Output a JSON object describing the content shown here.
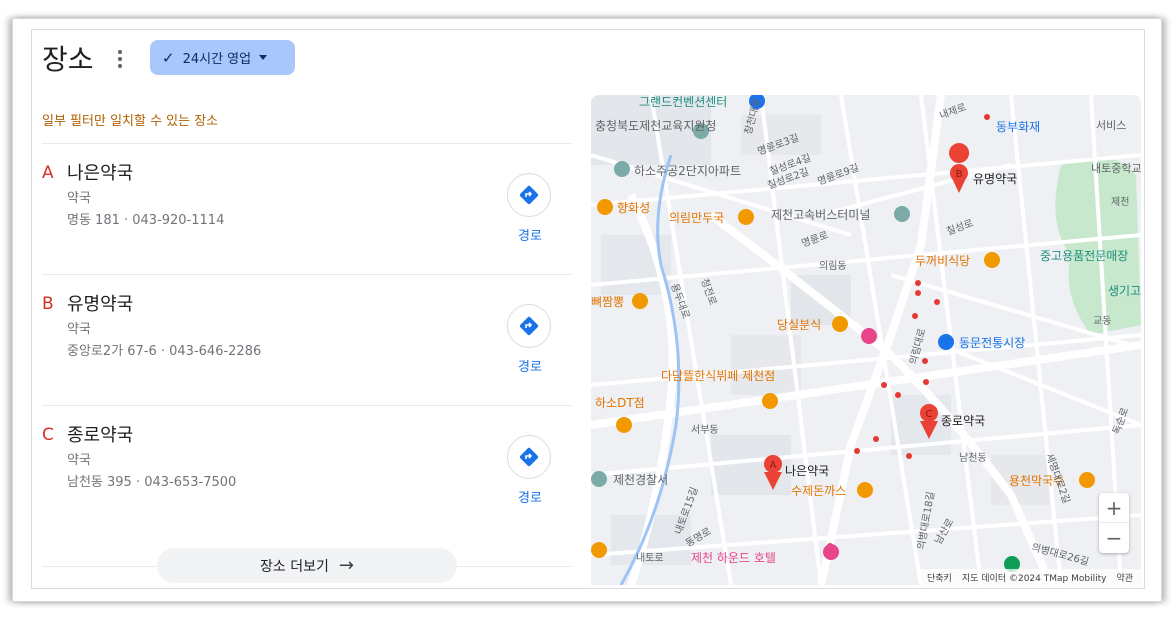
{
  "header": {
    "title": "장소",
    "filter_chip_label": "24시간 영업"
  },
  "notice": "일부 필터만 일치할 수 있는 장소",
  "results": [
    {
      "marker": "A",
      "name": "나은약국",
      "type": "약국",
      "address": "명동 181 · 043-920-1114",
      "directions_label": "경로"
    },
    {
      "marker": "B",
      "name": "유명약국",
      "type": "약국",
      "address": "중앙로2가 67-6 · 043-646-2286",
      "directions_label": "경로"
    },
    {
      "marker": "C",
      "name": "종로약국",
      "type": "약국",
      "address": "남천동 395 · 043-653-7500",
      "directions_label": "경로"
    }
  ],
  "more_places_label": "장소 더보기",
  "map": {
    "pins": [
      {
        "letter": "A",
        "label": "나은약국"
      },
      {
        "letter": "B",
        "label": "유명약국"
      },
      {
        "letter": "C",
        "label": "종로약국"
      }
    ],
    "orange_labels": [
      "향화성",
      "의림만두국",
      "두꺼비식당",
      "당실분식",
      "다담뜰한식뷔페 제천점",
      "하소DT점",
      "수제돈까스",
      "용천막국수",
      "뼈짬뽕"
    ],
    "blue_labels": [
      "동부화재",
      "동문전통시장"
    ],
    "teal_labels": [
      "그랜드컨벤션센터",
      "중고용품전문매장",
      "생기고"
    ],
    "gray_labels": [
      "충청북도제천교육지원청",
      "하소주공2단지아파트",
      "제천고속버스터미널",
      "제천경찰서",
      "내토중학교",
      "서비스"
    ],
    "pink_labels": [
      "제천 하운드 호텔"
    ],
    "street_labels": [
      "창천대로",
      "명륜로3길",
      "칠성로4길",
      "칠성로2길",
      "명륜로",
      "의림동",
      "명륜로9길",
      "내제로",
      "칠성로",
      "의림대로",
      "용두대로",
      "청전로",
      "내토로15길",
      "동명로",
      "서부동",
      "남천동",
      "교동",
      "세명대로2길",
      "독순로",
      "제천",
      "내토로",
      "남산로",
      "의병대로18길",
      "의병대로26길"
    ],
    "attribution": {
      "shortcuts": "단축키",
      "map_data": "지도 데이터 ©2024 TMap Mobility",
      "terms": "약관"
    },
    "zoom_in": "+",
    "zoom_out": "−"
  },
  "colors": {
    "chip_bg": "#a8c7fa",
    "marker_red": "#d93025",
    "link_blue": "#1a73e8",
    "notice_orange": "#b06000",
    "map_orange": "#e37400",
    "map_blue": "#1a73e8"
  }
}
